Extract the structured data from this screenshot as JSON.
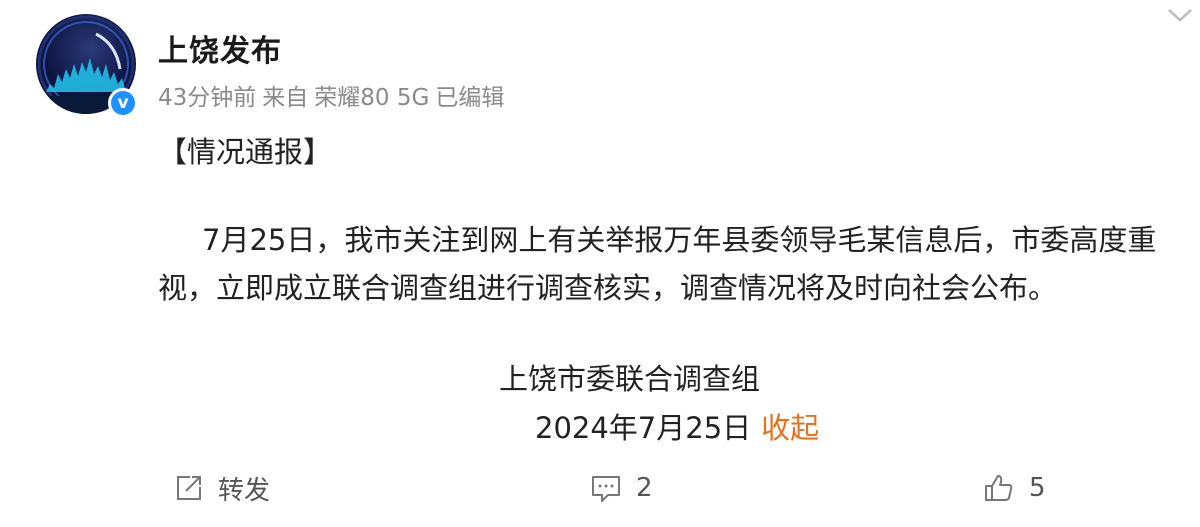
{
  "account": {
    "name": "上饶发布",
    "verified_badge": "v",
    "avatar": "city-skyline-avatar"
  },
  "meta": {
    "time": "43分钟前",
    "source_prefix": "来自",
    "device": "荣耀80 5G",
    "edited": "已编辑"
  },
  "post": {
    "heading": "【情况通报】",
    "paragraph": "7月25日，我市关注到网上有关举报万年县委领导毛某信息后，市委高度重视，立即成立联合调查组进行调查核实，调查情况将及时向社会公布。",
    "signature": "上饶市委联合调查组",
    "date": "2024年7月25日",
    "collapse_label": "收起"
  },
  "actions": {
    "repost_label": "转发",
    "comment_count": "2",
    "like_count": "5"
  },
  "colors": {
    "accent": "#e8711a",
    "verified": "#1e90ff",
    "meta_text": "#8a8a8a"
  }
}
